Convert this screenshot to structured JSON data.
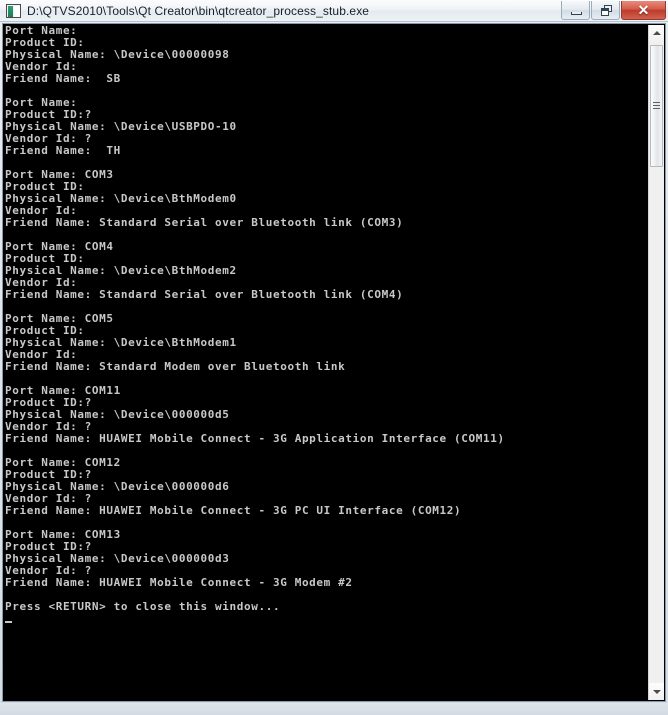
{
  "window": {
    "title": "D:\\QTVS2010\\Tools\\Qt Creator\\bin\\qtcreator_process_stub.exe",
    "icon": "console-window-icon",
    "buttons": {
      "minimize_label": "",
      "maximize_label": "",
      "close_label": "✕"
    }
  },
  "console": {
    "background_color": "#000000",
    "text_color": "#c8c8c8",
    "lines": [
      "Port Name:",
      "Product ID:",
      "Physical Name: \\Device\\00000098",
      "Vendor Id:",
      "Friend Name:  SB",
      "",
      "Port Name:",
      "Product ID:?",
      "Physical Name: \\Device\\USBPDO-10",
      "Vendor Id: ?",
      "Friend Name:  TH",
      "",
      "Port Name: COM3",
      "Product ID:",
      "Physical Name: \\Device\\BthModem0",
      "Vendor Id:",
      "Friend Name: Standard Serial over Bluetooth link (COM3)",
      "",
      "Port Name: COM4",
      "Product ID:",
      "Physical Name: \\Device\\BthModem2",
      "Vendor Id:",
      "Friend Name: Standard Serial over Bluetooth link (COM4)",
      "",
      "Port Name: COM5",
      "Product ID:",
      "Physical Name: \\Device\\BthModem1",
      "Vendor Id:",
      "Friend Name: Standard Modem over Bluetooth link",
      "",
      "Port Name: COM11",
      "Product ID:?",
      "Physical Name: \\Device\\000000d5",
      "Vendor Id: ?",
      "Friend Name: HUAWEI Mobile Connect - 3G Application Interface (COM11)",
      "",
      "Port Name: COM12",
      "Product ID:?",
      "Physical Name: \\Device\\000000d6",
      "Vendor Id: ?",
      "Friend Name: HUAWEI Mobile Connect - 3G PC UI Interface (COM12)",
      "",
      "Port Name: COM13",
      "Product ID:?",
      "Physical Name: \\Device\\000000d3",
      "Vendor Id: ?",
      "Friend Name: HUAWEI Mobile Connect - 3G Modem #2",
      "",
      "Press <RETURN> to close this window..."
    ],
    "cursor": "_"
  },
  "scrollbar": {
    "up_arrow": "▲",
    "down_arrow": "▼",
    "orientation": "vertical"
  }
}
